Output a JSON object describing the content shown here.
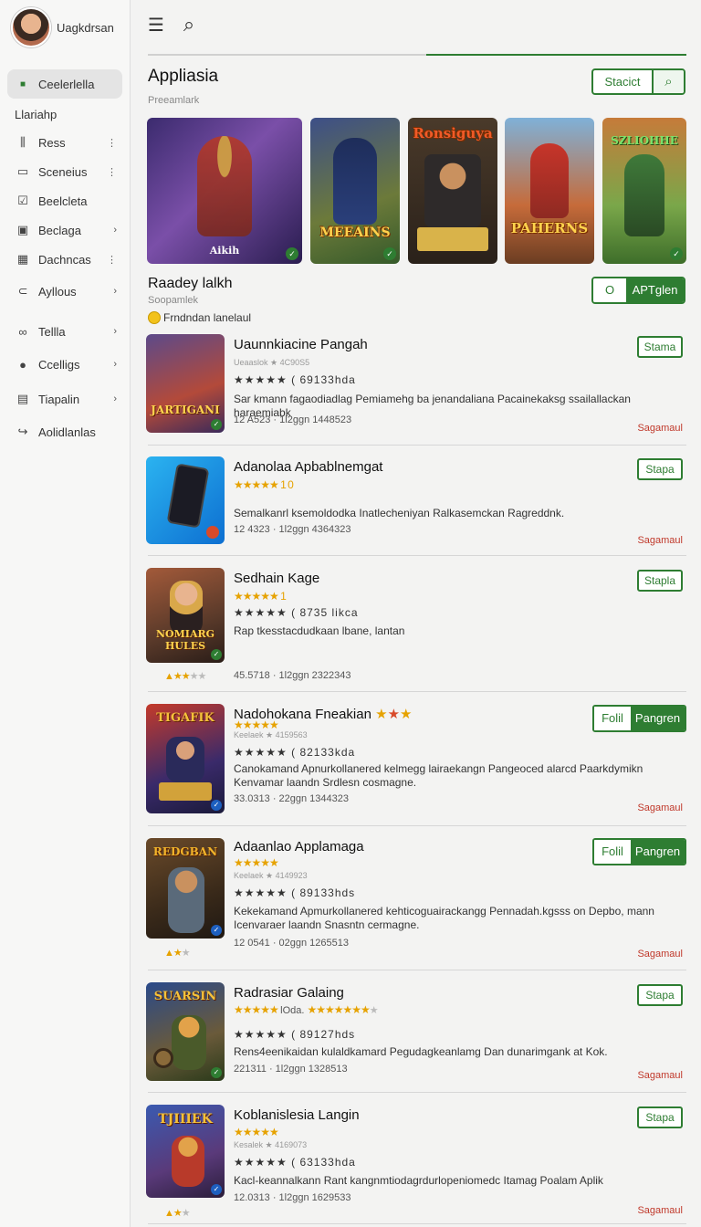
{
  "profile": {
    "name": "Uagkdrsan"
  },
  "sidebar": {
    "items": [
      {
        "label": "Ceelerlella",
        "icon": "square-icon",
        "glyph": "■"
      },
      {
        "label": "Llariahp",
        "icon": "",
        "glyph": ""
      },
      {
        "label": "Ress",
        "icon": "bars-icon",
        "glyph": "⫼"
      },
      {
        "label": "Sceneius",
        "icon": "screen-icon",
        "glyph": "▭"
      },
      {
        "label": "Beelcleta",
        "icon": "check-box-icon",
        "glyph": "☑"
      },
      {
        "label": "Beclaga",
        "icon": "image-icon",
        "glyph": "▣"
      },
      {
        "label": "Dachncas",
        "icon": "grid-icon",
        "glyph": "▦"
      },
      {
        "label": "Ayllous",
        "icon": "folder-icon",
        "glyph": "⊂"
      },
      {
        "label": "Tellla",
        "icon": "dots-icon",
        "glyph": "∞"
      },
      {
        "label": "Ccelligs",
        "icon": "person-icon",
        "glyph": "●"
      },
      {
        "label": "Tiapalin",
        "icon": "table-icon",
        "glyph": "▤"
      },
      {
        "label": "Aolidlanlas",
        "icon": "share-icon",
        "glyph": "↪"
      }
    ]
  },
  "topbar": {
    "menu_icon": "☰",
    "search_icon": "⌕"
  },
  "header": {
    "title": "Appliasia",
    "subtitle": "Preeamlark",
    "search_label": "Stacict",
    "search_go": "⌕"
  },
  "banners": [
    {
      "caption": "Aikih"
    },
    {
      "caption": "MEEAINS"
    },
    {
      "caption": "Ronsiguya"
    },
    {
      "caption": "PAHERNS"
    },
    {
      "caption": "SZLIOHHE"
    }
  ],
  "section": {
    "title": "Raadey lalkh",
    "subtitle": "Soopamlek",
    "note": "Frndndan lanelaul",
    "btn_a": "O",
    "btn_b": "APTglen"
  },
  "apps": [
    {
      "name": "Uaunnkiacine Pangah",
      "sub": "Ueaaslok ★ 4C90S5",
      "rating": "★★★★★  ( 69133hda",
      "desc": "Sar kmann fagaodiadlag Pemiamehg ba jenandaliana Pacainekaksg ssailallackan haraemiabk",
      "meta": "12 A523  ·  1l2ggn   1448523",
      "more": "Sagamaul",
      "btn": "Stama",
      "thumb": "JARTIGANI"
    },
    {
      "name": "Adanolaa Apbablnemgat",
      "sub": "",
      "rating": "★★★★★ 1 0",
      "desc": "Semalkanrl ksemoldodka Inatlecheniyan Ralkasemckan Ragreddnk.",
      "meta": "12 4323  ·  1l2ggn   4364323",
      "more": "Sagamaul",
      "btn": "Stapa",
      "thumb": ""
    },
    {
      "name": "Sedhain Kage",
      "sub": "",
      "rating": "★★★★★ ( 8735 likca",
      "desc": "Rap tkesstacdudkaan lbane, lantan",
      "meta": "45.5718  ·  1l2ggn   2322343",
      "more": "",
      "btn": "Stapla",
      "thumb": "NOMIARG HULES"
    },
    {
      "name": "Nadohokana Fneakian",
      "sub": "Keelaek ★ 4159563",
      "rating": "★★★★★  ( 82133kda",
      "desc": "Canokamand Apnurkollanered kelmegg lairaekangn Pangeoced alarcd Paarkdymikn Kenvamar laandn Srdlesn cosmagne.",
      "meta": "33.0313  ·  22ggn   1344323",
      "more": "Sagamaul",
      "btn_a": "Folil",
      "btn_b": "Pangren",
      "thumb": "TIGAFIK"
    },
    {
      "name": "Adaanlao Applamaga",
      "sub": "Keelaek ★ 4149923",
      "rating": "★★★★★  ( 89133hds",
      "desc": "Kekekamand Apmurkollanered kehticoguairackangg Pennadah.kgsss on Depbo, mann Icenvaraer laandn Snasntn cermagne.",
      "meta": "12 0541  ·  02ggn   1265513",
      "more": "Sagamaul",
      "btn_a": "Folil",
      "btn_b": "Pangren",
      "thumb": "REDGBAN"
    },
    {
      "name": "Radrasiar Galaing",
      "sub": "lOda.",
      "rating": "★★★★★  ( 89127hds",
      "desc": "Rens4eenikaidan kulaldkamard Pegudagkeanlamg Dan dunarimgank at Kok.",
      "meta": "221311  ·  1l2ggn   1328513",
      "more": "Sagamaul",
      "btn": "Stapa",
      "thumb": "SUARSIN"
    },
    {
      "name": "Koblanislesia Langin",
      "sub": "Kesalek ★ 4169073",
      "rating": "★★★★★  ( 63133hda",
      "desc": "Kacl-keannalkann Rant kangnmtiodagrdurlopeniomedc Itamag Poalam Aplik",
      "meta": "12.0313  ·  1l2ggn   1629533",
      "more": "Sagamaul",
      "btn": "Stapa",
      "thumb": "TJIIIEK"
    }
  ]
}
